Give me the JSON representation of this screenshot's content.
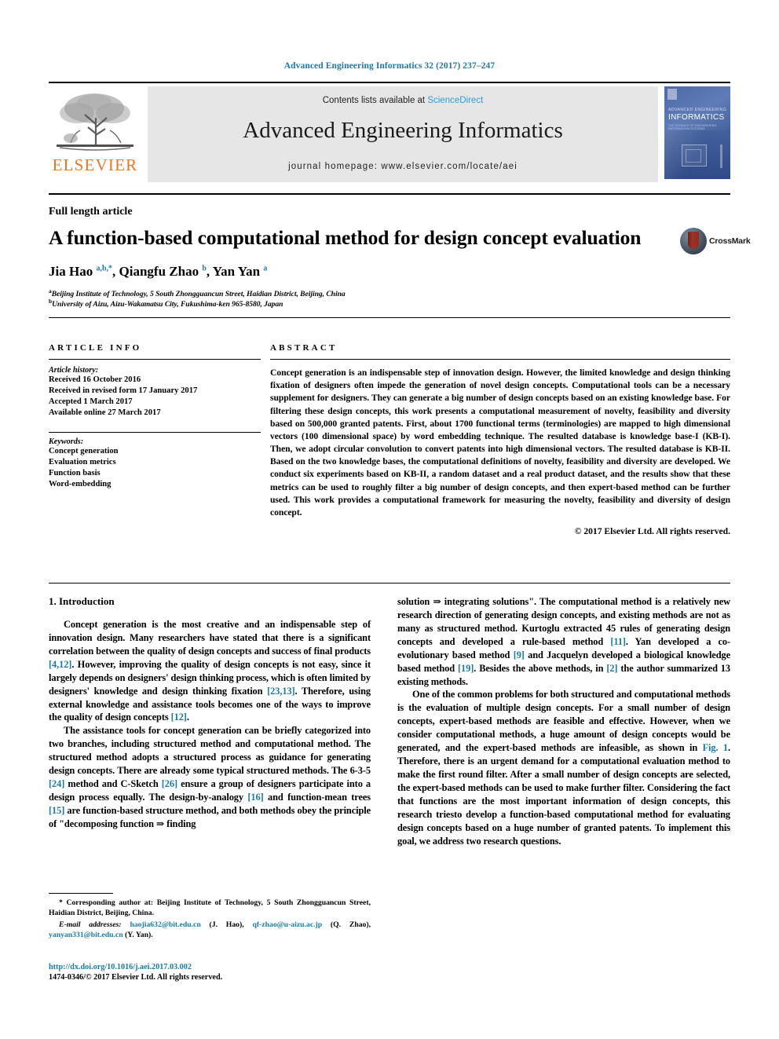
{
  "running_head": "Advanced Engineering Informatics 32 (2017) 237–247",
  "masthead": {
    "publisher_name": "ELSEVIER",
    "contents_prefix": "Contents lists available at ",
    "sciencedirect": "ScienceDirect",
    "journal_title": "Advanced Engineering Informatics",
    "homepage": "journal homepage: www.elsevier.com/locate/aei",
    "cover": {
      "line1": "ADVANCED ENGINEERING",
      "line2": "INFORMATICS",
      "line3": "THE SCIENCE OF ENGINEERING INFORMATION SYSTEMS"
    }
  },
  "article": {
    "kicker": "Full length article",
    "title": "A function-based computational method for design concept evaluation",
    "crossmark_label": "CrossMark",
    "authors_html": "Jia Hao <sup>a,b,*</sup>, Qiangfu Zhao <sup>b</sup>, Yan Yan <sup>a</sup>",
    "affiliation_a": "Beijing Institute of Technology, 5 South Zhongguancun Street, Haidian District, Beijing, China",
    "affiliation_b": "University of Aizu, Aizu-Wakamatsu City, Fukushima-ken 965-8580, Japan"
  },
  "info": {
    "heading": "ARTICLE INFO",
    "history_label": "Article history:",
    "history": [
      "Received 16 October 2016",
      "Received in revised form 17 January 2017",
      "Accepted 1 March 2017",
      "Available online 27 March 2017"
    ],
    "keywords_label": "Keywords:",
    "keywords": [
      "Concept generation",
      "Evaluation metrics",
      "Function basis",
      "Word-embedding"
    ]
  },
  "abstract": {
    "heading": "ABSTRACT",
    "text": "Concept generation is an indispensable step of innovation design. However, the limited knowledge and design thinking fixation of designers often impede the generation of novel design concepts. Computational tools can be a necessary supplement for designers. They can generate a big number of design concepts based on an existing knowledge base. For filtering these design concepts, this work presents a computational measurement of novelty, feasibility and diversity based on 500,000 granted patents. First, about 1700 functional terms (terminologies) are mapped to high dimensional vectors (100 dimensional space) by word embedding technique. The resulted database is knowledge base-I (KB-I). Then, we adopt circular convolution to convert patents into high dimensional vectors. The resulted database is KB-II. Based on the two knowledge bases, the computational definitions of novelty, feasibility and diversity are developed. We conduct six experiments based on KB-II, a random dataset and a real product dataset, and the results show that these metrics can be used to roughly filter a big number of design concepts, and then expert-based method can be further used. This work provides a computational framework for measuring the novelty, feasibility and diversity of design concept.",
    "copyright": "© 2017 Elsevier Ltd. All rights reserved."
  },
  "body": {
    "section_heading": "1. Introduction",
    "left_paragraphs": [
      "Concept generation is the most creative and an indispensable step of innovation design. Many researchers have stated that there is a significant correlation between the quality of design concepts and success of final products [4,12]. However, improving the quality of design concepts is not easy, since it largely depends on designers' design thinking process, which is often limited by designers' knowledge and design thinking fixation [23,13]. Therefore, using external knowledge and assistance tools becomes one of the ways to improve the quality of design concepts [12].",
      "The assistance tools for concept generation can be briefly categorized into two branches, including structured method and computational method. The structured method adopts a structured process as guidance for generating design concepts. There are already some typical structured methods. The 6-3-5 [24] method and C-Sketch [26] ensure a group of designers participate into a design process equally. The design-by-analogy [16] and function-mean trees [15] are function-based structure method, and both methods obey the principle of \"decomposing function ⇒ finding"
    ],
    "right_paragraphs": [
      "solution ⇒ integrating solutions\". The computational method is a relatively new research direction of generating design concepts, and existing methods are not as many as structured method. Kurtoglu extracted 45 rules of generating design concepts and developed a rule-based method [11]. Yan developed a co-evolutionary based method [9] and Jacquelyn developed a biological knowledge based method [19]. Besides the above methods, in [2] the author summarized 13 existing methods.",
      "One of the common problems for both structured and computational methods is the evaluation of multiple design concepts. For a small number of design concepts, expert-based methods are feasible and effective. However, when we consider computational methods, a huge amount of design concepts would be generated, and the expert-based methods are infeasible, as shown in Fig. 1. Therefore, there is an urgent demand for a computational evaluation method to make the first round filter. After a small number of design concepts are selected, the expert-based methods can be used to make further filter. Considering the fact that functions are the most important information of design concepts, this research triesto develop a function-based computational method for evaluating design concepts based on a huge number of granted patents. To implement this goal, we address two research questions."
    ]
  },
  "footnotes": {
    "corresponding": "* Corresponding author at: Beijing Institute of Technology, 5 South Zhongguancun Street, Haidian District, Beijing, China.",
    "email_label": "E-mail addresses:",
    "emails": [
      {
        "address": "haojia632@bit.edu.cn",
        "person": "(J. Hao)"
      },
      {
        "address": "qf-zhao@u-aizu.ac.jp",
        "person": "(Q. Zhao)"
      },
      {
        "address": "yanyan331@bit.edu.cn",
        "person": "(Y. Yan)"
      }
    ],
    "doi": "http://dx.doi.org/10.1016/j.aei.2017.03.002",
    "issn_line": "1474-0346/© 2017 Elsevier Ltd. All rights reserved."
  },
  "colors": {
    "link": "#1a7aa8",
    "elsevier_orange": "#E87722",
    "sciencedirect": "#2a9fd6",
    "band_bg": "#e6e6e6"
  }
}
